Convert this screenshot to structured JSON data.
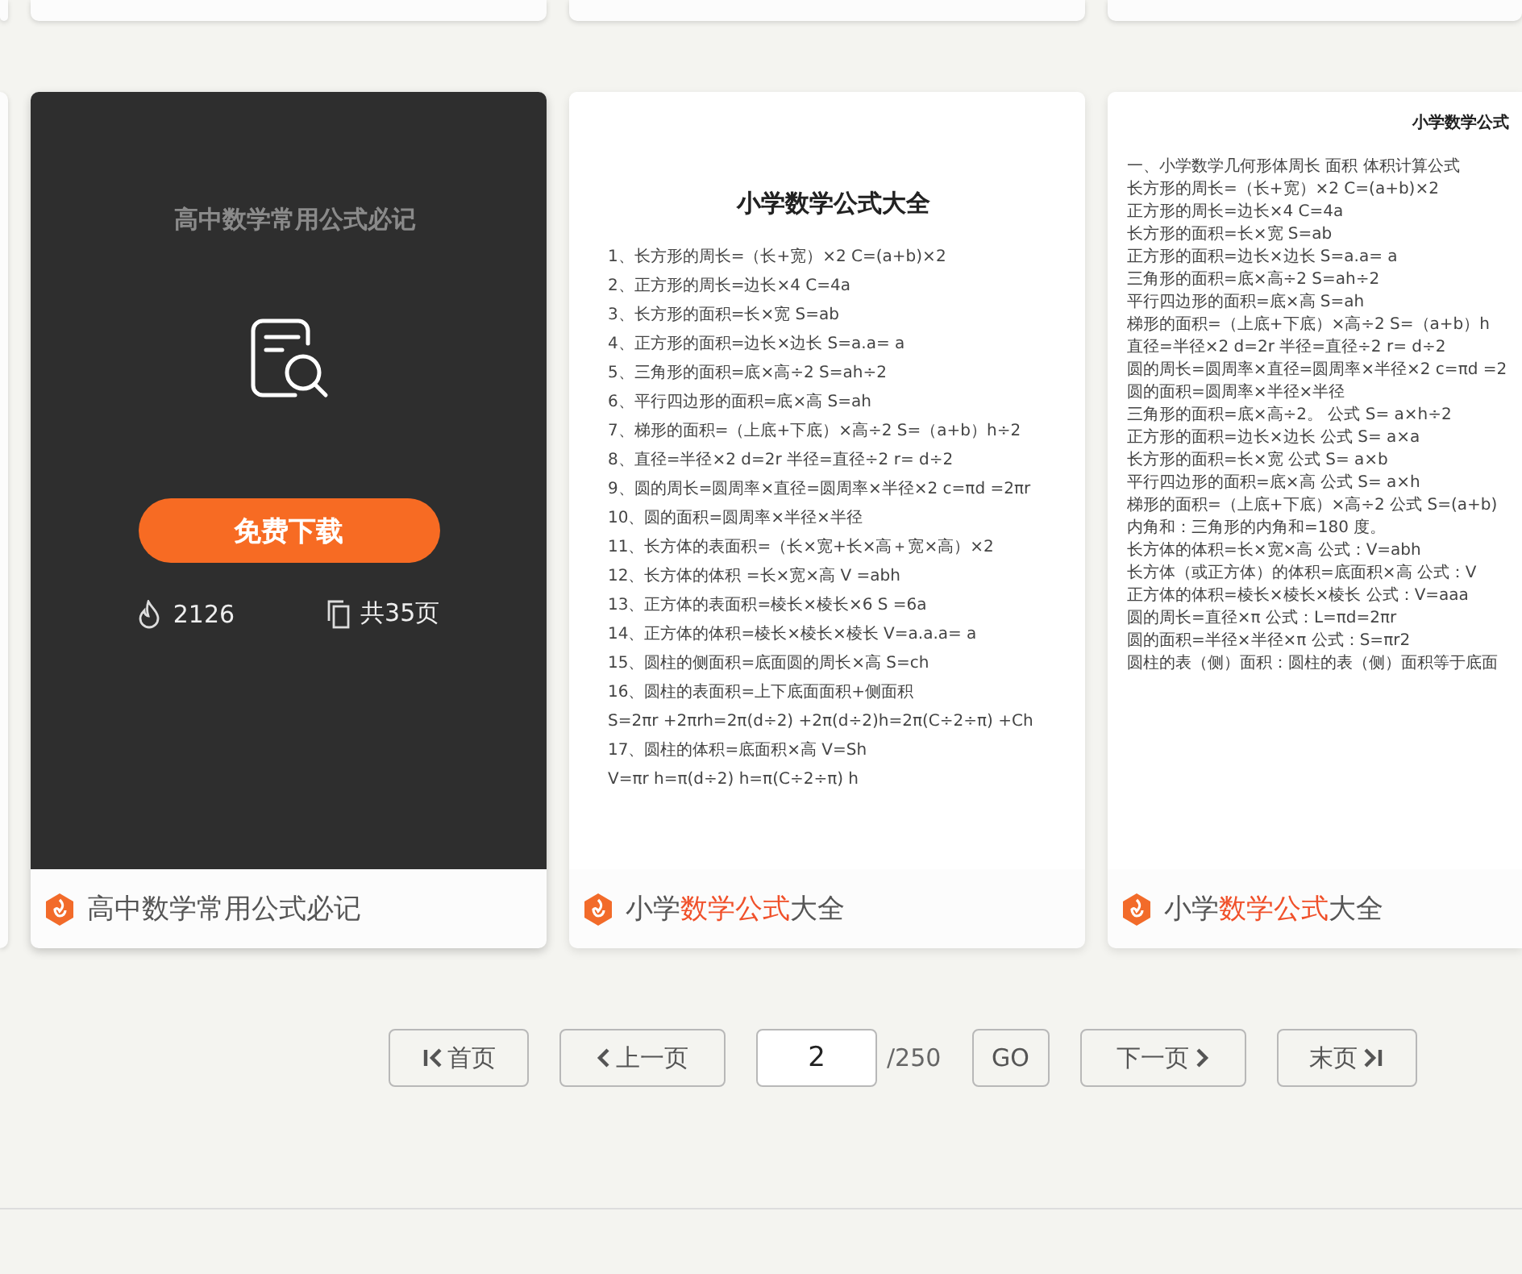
{
  "cards": [
    {
      "title": [
        {
          "text": "高中数学常用公式必记",
          "highlight": false
        }
      ],
      "document": {
        "title": "高中数学常用公式必记"
      },
      "overlay": {
        "button": "免费下载",
        "views": "2126",
        "pages": "共35页"
      }
    },
    {
      "title": [
        {
          "text": "小学",
          "highlight": false
        },
        {
          "text": "数学公式",
          "highlight": true
        },
        {
          "text": "大全",
          "highlight": false
        }
      ],
      "document": {
        "title": "小学数学公式大全",
        "lines": [
          "1、长方形的周长=（长+宽）×2 C=(a+b)×2",
          "2、正方形的周长=边长×4 C=4a",
          "3、长方形的面积=长×宽 S=ab",
          "4、正方形的面积=边长×边长 S=a.a= a",
          "5、三角形的面积=底×高÷2 S=ah÷2",
          "6、平行四边形的面积=底×高 S=ah",
          "7、梯形的面积=（上底+下底）×高÷2 S=（a+b）h÷2",
          "8、直径=半径×2 d=2r 半径=直径÷2 r= d÷2",
          "9、圆的周长=圆周率×直径=圆周率×半径×2 c=πd =2πr",
          "10、圆的面积=圆周率×半径×半径",
          "11、长方体的表面积=（长×宽+长×高＋宽×高）×2",
          "12、长方体的体积 =长×宽×高 V =abh",
          "13、正方体的表面积=棱长×棱长×6 S =6a",
          "14、正方体的体积=棱长×棱长×棱长 V=a.a.a= a",
          "15、圆柱的侧面积=底面圆的周长×高 S=ch",
          "16、圆柱的表面积=上下底面面积+侧面积",
          "S=2πr +2πrh=2π(d÷2) +2π(d÷2)h=2π(C÷2÷π) +Ch",
          "17、圆柱的体积=底面积×高 V=Sh",
          "V=πr h=π(d÷2) h=π(C÷2÷π) h"
        ]
      }
    },
    {
      "title": [
        {
          "text": "小学",
          "highlight": false
        },
        {
          "text": "数学公式",
          "highlight": true
        },
        {
          "text": "大全",
          "highlight": false
        }
      ],
      "document": {
        "title": "小学数学公式",
        "lines": [
          "一、小学数学几何形体周长 面积 体积计算公式",
          "长方形的周长=（长+宽）×2 C=(a+b)×2",
          "正方形的周长=边长×4 C=4a",
          "长方形的面积=长×宽 S=ab",
          "正方形的面积=边长×边长 S=a.a= a",
          "三角形的面积=底×高÷2 S=ah÷2",
          "平行四边形的面积=底×高 S=ah",
          "梯形的面积=（上底+下底）×高÷2 S=（a+b）h",
          "直径=半径×2 d=2r 半径=直径÷2 r= d÷2",
          "圆的周长=圆周率×直径=圆周率×半径×2 c=πd =2",
          "圆的面积=圆周率×半径×半径",
          "三角形的面积=底×高÷2。 公式 S= a×h÷2",
          "正方形的面积=边长×边长 公式 S= a×a",
          "长方形的面积=长×宽 公式 S= a×b",
          "平行四边形的面积=底×高 公式 S= a×h",
          "梯形的面积=（上底+下底）×高÷2 公式 S=(a+b)",
          "内角和：三角形的内角和=180 度。",
          "长方体的体积=长×宽×高 公式：V=abh",
          "长方体（或正方体）的体积=底面积×高 公式：V",
          "正方体的体积=棱长×棱长×棱长 公式：V=aaa",
          "圆的周长=直径×π 公式：L=πd=2πr",
          "圆的面积=半径×半径×π 公式：S=πr2",
          "圆柱的表（侧）面积：圆柱的表（侧）面积等于底面"
        ]
      }
    }
  ],
  "pagination": {
    "first": "首页",
    "prev": "上一页",
    "page": "2",
    "total": "/250",
    "go": "GO",
    "next": "下一页",
    "last": "末页"
  }
}
